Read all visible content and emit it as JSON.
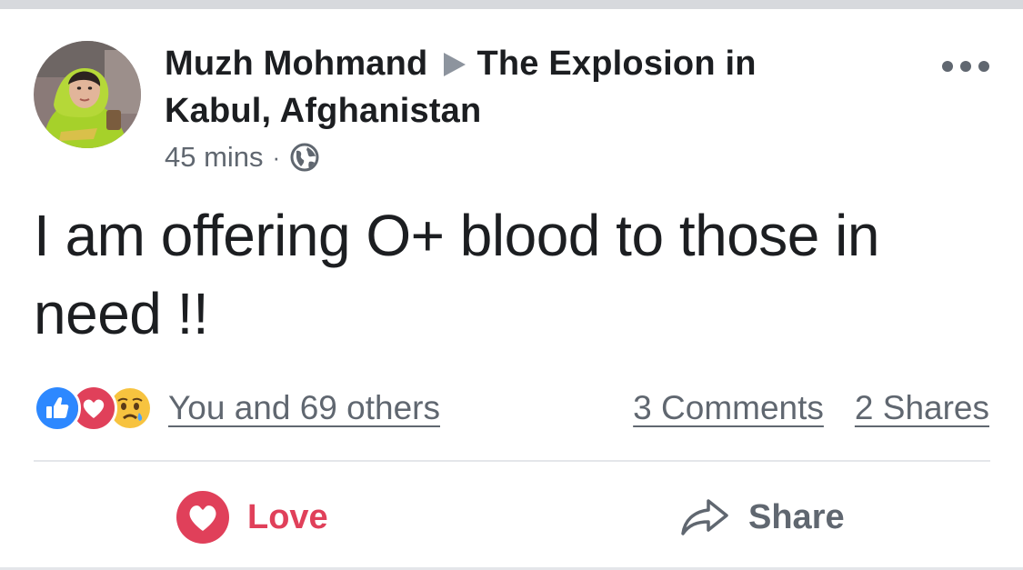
{
  "post": {
    "author": "Muzh Mohmand",
    "target": "The Explosion in Kabul, Afghanistan",
    "time": "45 mins",
    "separator": "·",
    "privacy_icon": "globe-icon",
    "text": "I am offering O+ blood to those in need !!"
  },
  "reactions": {
    "icons": [
      "like-icon",
      "love-icon",
      "sad-icon"
    ],
    "summary": "You and 69 others",
    "comments": "3 Comments",
    "shares": "2 Shares"
  },
  "actions": {
    "love_label": "Love",
    "share_label": "Share"
  },
  "colors": {
    "love": "#e0405a",
    "like": "#2d88ff",
    "text_primary": "#1c1e21",
    "text_secondary": "#606770",
    "divider": "#e4e6ea"
  }
}
